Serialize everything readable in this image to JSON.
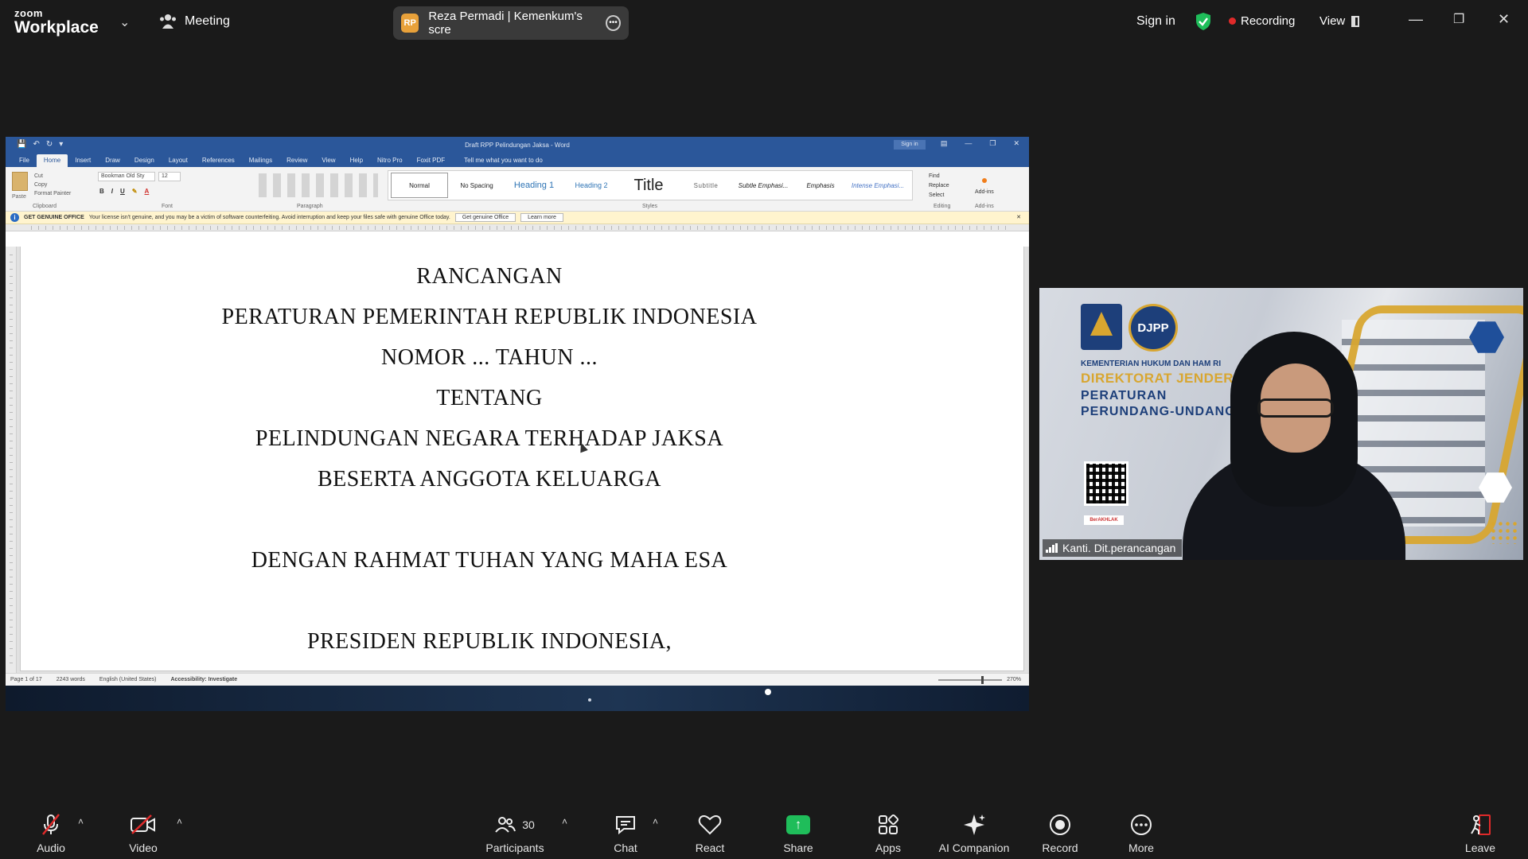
{
  "app": {
    "brand_top": "zoom",
    "brand_bottom": "Workplace",
    "meeting_label": "Meeting"
  },
  "share_pill": {
    "initials": "RP",
    "title": "Reza Permadi | Kemenkum's scre"
  },
  "top_right": {
    "sign_in": "Sign in",
    "recording": "Recording",
    "view": "View"
  },
  "word": {
    "doc_title": "Draft RPP Pelindungan Jaksa - Word",
    "sign_in": "Sign in",
    "tabs": [
      "File",
      "Home",
      "Insert",
      "Draw",
      "Design",
      "Layout",
      "References",
      "Mailings",
      "Review",
      "View",
      "Help",
      "Nitro Pro",
      "Foxit PDF"
    ],
    "active_tab": "Home",
    "tell_me": "Tell me what you want to do",
    "clipboard": {
      "paste": "Paste",
      "cut": "Cut",
      "copy": "Copy",
      "format_painter": "Format Painter",
      "label": "Clipboard"
    },
    "font": {
      "name": "Bookman Old Sty",
      "size": "12",
      "label": "Font"
    },
    "paragraph_label": "Paragraph",
    "styles": [
      "Normal",
      "No Spacing",
      "Heading 1",
      "Heading 2",
      "Title",
      "Subtitle",
      "Subtle Emphasi...",
      "Emphasis",
      "Intense Emphasi..."
    ],
    "styles_label": "Styles",
    "editing": {
      "find": "Find",
      "replace": "Replace",
      "select": "Select",
      "label": "Editing"
    },
    "addins": {
      "label": "Add-ins",
      "group": "Add-ins"
    },
    "infobar": {
      "heading": "GET GENUINE OFFICE",
      "message": "Your license isn't genuine, and you may be a victim of software counterfeiting. Avoid interruption and keep your files safe with genuine Office today.",
      "btn1": "Get genuine Office",
      "btn2": "Learn more"
    },
    "document_lines": [
      "RANCANGAN",
      "PERATURAN PEMERINTAH REPUBLIK INDONESIA",
      "NOMOR ... TAHUN ...",
      "TENTANG",
      "PELINDUNGAN NEGARA TERHADAP JAKSA",
      "BESERTA ANGGOTA KELUARGA",
      "DENGAN RAHMAT TUHAN YANG MAHA ESA",
      "PRESIDEN REPUBLIK INDONESIA,"
    ],
    "status": {
      "page": "Page 1 of 17",
      "words": "2243 words",
      "language": "English (United States)",
      "accessibility": "Accessibility: Investigate",
      "zoom": "270%"
    }
  },
  "video": {
    "participant_name": "Kanti. Dit.perancangan",
    "background": {
      "logo_text": "DJPP",
      "line1": "KEMENTERIAN HUKUM DAN HAM RI",
      "line2": "DIREKTORAT JENDERAL",
      "line3": "PERATURAN",
      "line4": "PERUNDANG-UNDANG",
      "badge": "BerAKHLAK"
    }
  },
  "toolbar": {
    "audio": "Audio",
    "video": "Video",
    "participants": "Participants",
    "participant_count": "30",
    "chat": "Chat",
    "react": "React",
    "share": "Share",
    "apps": "Apps",
    "ai_companion": "AI Companion",
    "record": "Record",
    "more": "More",
    "leave": "Leave"
  },
  "colors": {
    "word_blue": "#2b579a",
    "share_green": "#1fbd5a",
    "recording_red": "#e02a2a",
    "djpp_gold": "#d8a630",
    "djpp_navy": "#1d3f7a"
  }
}
